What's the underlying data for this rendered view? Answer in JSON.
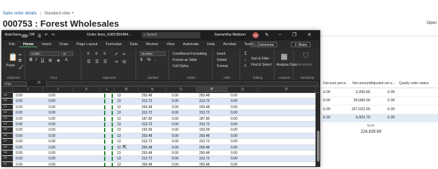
{
  "background": {
    "breadcrumb": {
      "link": "Sales order details",
      "separator": "|",
      "view": "Standard view",
      "view_chevron": "˅"
    },
    "title": "000753 : Forest Wholesales",
    "open_label": "Open",
    "grid": {
      "headers": [
        "Discount perce...",
        "Net amount",
        "Adjusted net a...",
        "Quality order status"
      ],
      "rows": [
        {
          "discount": "0.00",
          "net": "2,206.60",
          "adjusted": "0.00",
          "status": ""
        },
        {
          "discount": "0.00",
          "net": "35,089.00",
          "adjusted": "0.00",
          "status": ""
        },
        {
          "discount": "0.00",
          "net": "157,022.00",
          "adjusted": "0.00",
          "status": ""
        },
        {
          "discount": "0.00",
          "net": "5,003.70",
          "adjusted": "0.00",
          "status": ""
        }
      ],
      "selected_row": 3,
      "sum_label": "Sum",
      "sum_value": "224,839.69"
    }
  },
  "excel": {
    "titlebar": {
      "autosave": "AutoSave",
      "autosave_state": "Off",
      "file_name": "Order lines_6381950484...",
      "search_placeholder": "Search",
      "user": "Samantha Mattson",
      "user_initials": "SM"
    },
    "menu_tabs": [
      "File",
      "Home",
      "Insert",
      "Draw",
      "Page Layout",
      "Formulas",
      "Data",
      "Review",
      "View",
      "Automate",
      "Help",
      "Acrobat",
      "Team"
    ],
    "active_tab": 1,
    "comments_label": "Comments",
    "share_label": "Share",
    "ribbon": {
      "clipboard": "Clipboard",
      "paste": "Paste",
      "font_group": "Font",
      "font_name": "Calibri",
      "font_size": "11",
      "alignment": "Alignment",
      "number_group": "Number",
      "number_format": "Number",
      "conditional": "Conditional Formatting",
      "format_table": "Format as Table",
      "cell_styles": "Cell Styles",
      "styles": "Styles",
      "insert": "Insert",
      "delete": "Delete",
      "format": "Format",
      "cells": "Cells",
      "sort_filter": "Sort & Filter",
      "find_select": "Find & Select",
      "editing": "Editing",
      "analyze": "Analyze Data",
      "analysis": "Analysis",
      "sensitivity": "Sensitivity",
      "sensitivity_group": "Sensitivity"
    },
    "name_box": "P16",
    "fx": "fx",
    "columns": [
      "I",
      "J",
      "K",
      "L",
      "M",
      "N",
      "O",
      "P",
      "Q",
      "R"
    ],
    "selected_column": "P",
    "rows": [
      {
        "n": "19",
        "i": "0.00",
        "j": "0.00",
        "m": "13",
        "n2": "293.48",
        "o": "0.00",
        "p": "293.48",
        "q": "0.00"
      },
      {
        "n": "20",
        "i": "0.00",
        "j": "0.00",
        "m": "13",
        "n2": "313.72",
        "o": "0.00",
        "p": "313.72",
        "q": "0.00"
      },
      {
        "n": "21",
        "i": "0.00",
        "j": "0.00",
        "m": "13",
        "n2": "293.48",
        "o": "0.00",
        "p": "293.48",
        "q": "0.00"
      },
      {
        "n": "22",
        "i": "0.00",
        "j": "0.00",
        "m": "13",
        "n2": "313.72",
        "o": "0.00",
        "p": "313.72",
        "q": "0.00"
      },
      {
        "n": "23",
        "i": "0.00",
        "j": "0.00",
        "m": "13",
        "n2": "187.90",
        "o": "0.00",
        "p": "187.90",
        "q": "0.00"
      },
      {
        "n": "24",
        "i": "0.00",
        "j": "0.00",
        "m": "13",
        "n2": "313.72",
        "o": "0.00",
        "p": "313.72",
        "q": "0.00"
      },
      {
        "n": "25",
        "i": "0.00",
        "j": "0.00",
        "m": "13",
        "n2": "193.09",
        "o": "0.00",
        "p": "193.09",
        "q": "0.00"
      },
      {
        "n": "26",
        "i": "0.00",
        "j": "0.00",
        "m": "13",
        "n2": "293.48",
        "o": "0.00",
        "p": "293.48",
        "q": "0.00"
      },
      {
        "n": "27",
        "i": "0.00",
        "j": "0.00",
        "m": "13",
        "n2": "313.72",
        "o": "0.00",
        "p": "313.72",
        "q": "0.00"
      },
      {
        "n": "28",
        "i": "0.00",
        "j": "0.00",
        "m": "13",
        "n2": "293.48",
        "o": "0.00",
        "p": "293.48",
        "q": "0.00"
      },
      {
        "n": "29",
        "i": "0.00",
        "j": "0.00",
        "m": "13",
        "n2": "293.48",
        "o": "0.00",
        "p": "293.48",
        "q": "0.00"
      },
      {
        "n": "30",
        "i": "0.00",
        "j": "0.00",
        "m": "13",
        "n2": "313.72",
        "o": "0.00",
        "p": "313.72",
        "q": "0.00"
      },
      {
        "n": "31",
        "i": "0.00",
        "j": "0.00",
        "m": "13",
        "n2": "293.48",
        "o": "0.00",
        "p": "293.48",
        "q": "0.00"
      }
    ],
    "total": {
      "n": "32",
      "p": "224,839.69"
    },
    "accent_color": "#4fa96b",
    "band_color": "#dde7f7"
  }
}
